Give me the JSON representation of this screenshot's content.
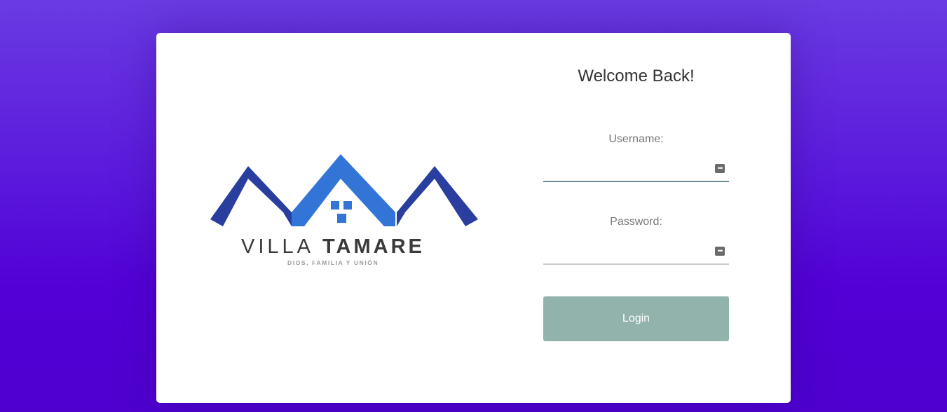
{
  "logo": {
    "brand_light": "VILLA",
    "brand_bold": "TAMARE",
    "tagline": "DIOS, FAMILIA Y UNIÓN",
    "colors": {
      "dark_blue": "#2a3ea0",
      "light_blue": "#3275d6",
      "text": "#3a3a3a",
      "tagline": "#9a9a9a"
    }
  },
  "form": {
    "title": "Welcome Back!",
    "username_label": "Username:",
    "username_value": "",
    "password_label": "Password:",
    "password_value": "",
    "login_label": "Login",
    "field_icon": "password-manager-key-icon"
  },
  "colors": {
    "background_top": "#6a3be2",
    "background_bottom": "#4f00cf",
    "button": "#92b2ac",
    "active_underline": "#6c8b90"
  }
}
